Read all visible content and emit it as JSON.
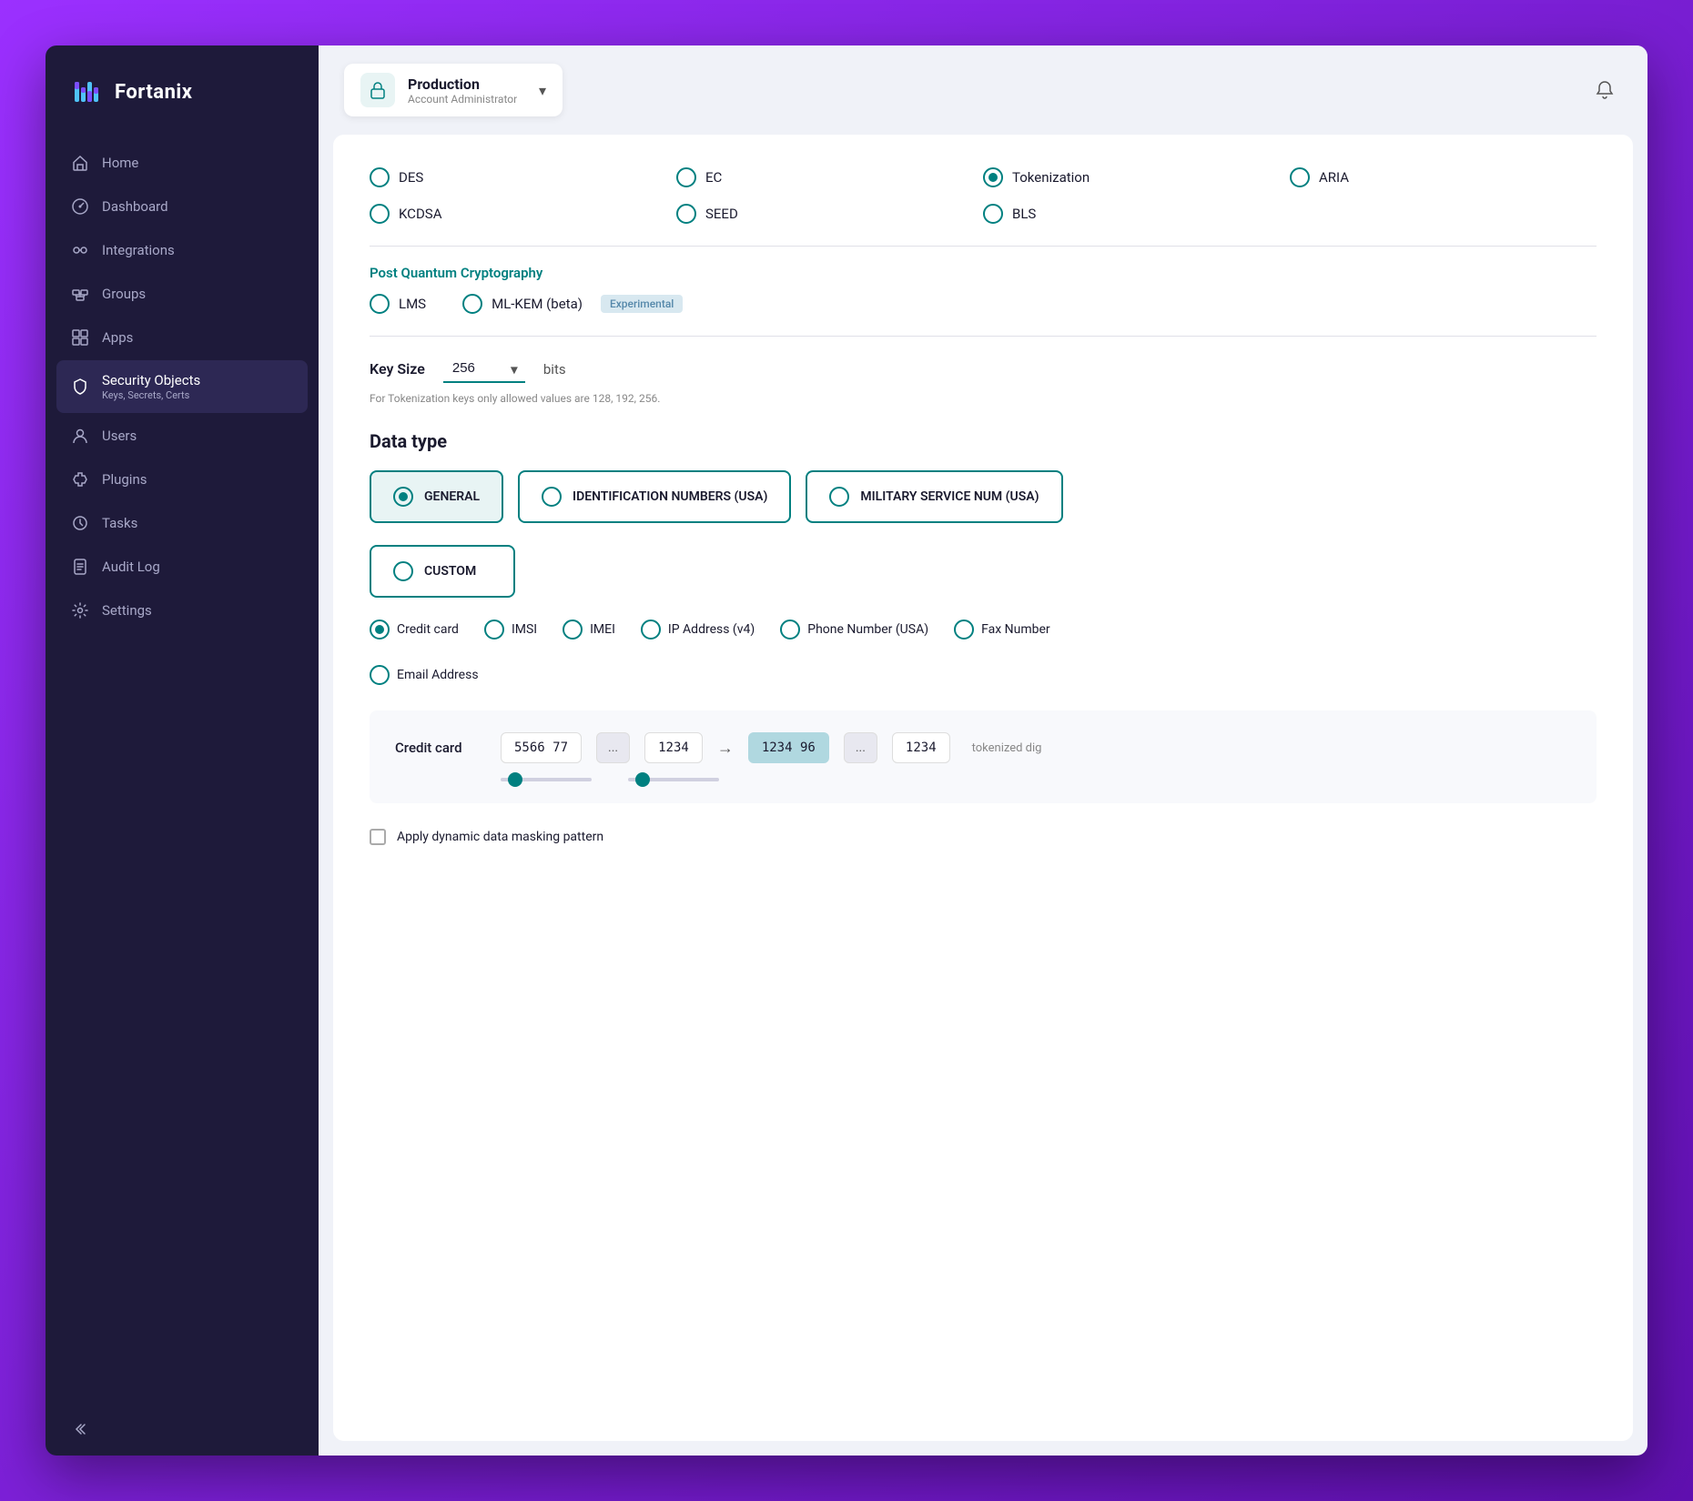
{
  "app": {
    "name": "Fortanix"
  },
  "account": {
    "name": "Production",
    "role": "Account Administrator",
    "icon": "🔒"
  },
  "sidebar": {
    "items": [
      {
        "id": "home",
        "label": "Home",
        "icon": "home"
      },
      {
        "id": "dashboard",
        "label": "Dashboard",
        "icon": "dashboard"
      },
      {
        "id": "integrations",
        "label": "Integrations",
        "icon": "integrations"
      },
      {
        "id": "groups",
        "label": "Groups",
        "icon": "groups"
      },
      {
        "id": "apps",
        "label": "Apps",
        "icon": "apps"
      },
      {
        "id": "security-objects",
        "label": "Security Objects",
        "sublabel": "Keys, Secrets, Certs",
        "icon": "security",
        "active": true
      },
      {
        "id": "users",
        "label": "Users",
        "icon": "users"
      },
      {
        "id": "plugins",
        "label": "Plugins",
        "icon": "plugins"
      },
      {
        "id": "tasks",
        "label": "Tasks",
        "icon": "tasks"
      },
      {
        "id": "audit-log",
        "label": "Audit Log",
        "icon": "audit"
      },
      {
        "id": "settings",
        "label": "Settings",
        "icon": "settings"
      }
    ],
    "collapse_label": ""
  },
  "algorithms": {
    "row1": [
      {
        "id": "des",
        "label": "DES",
        "selected": false
      },
      {
        "id": "ec",
        "label": "EC",
        "selected": false
      },
      {
        "id": "tokenization",
        "label": "Tokenization",
        "selected": true
      },
      {
        "id": "aria",
        "label": "ARIA",
        "selected": false
      }
    ],
    "row2": [
      {
        "id": "kcdsa",
        "label": "KCDSA",
        "selected": false
      },
      {
        "id": "seed",
        "label": "SEED",
        "selected": false
      },
      {
        "id": "bls",
        "label": "BLS",
        "selected": false
      }
    ]
  },
  "pqc": {
    "title": "Post Quantum Cryptography",
    "options": [
      {
        "id": "lms",
        "label": "LMS",
        "selected": false
      },
      {
        "id": "ml-kem",
        "label": "ML-KEM (beta)",
        "selected": false,
        "badge": "Experimental"
      }
    ]
  },
  "key_size": {
    "label": "Key Size",
    "value": "256",
    "options": [
      "128",
      "192",
      "256"
    ],
    "unit": "bits",
    "hint": "For Tokenization keys only allowed values are 128, 192, 256."
  },
  "data_type": {
    "section_title": "Data type",
    "options": [
      {
        "id": "general",
        "label": "GENERAL",
        "selected": true
      },
      {
        "id": "identification-numbers",
        "label": "IDENTIFICATION NUMBERS (USA)",
        "selected": false,
        "wide": true
      },
      {
        "id": "military-service",
        "label": "MILITARY SERVICE NUM (USA)",
        "selected": false,
        "wide": true
      }
    ],
    "custom": {
      "id": "custom",
      "label": "CUSTOM",
      "selected": false
    }
  },
  "token_options": [
    {
      "id": "credit-card",
      "label": "Credit card",
      "selected": true
    },
    {
      "id": "imsi",
      "label": "IMSI",
      "selected": false
    },
    {
      "id": "imei",
      "label": "IMEI",
      "selected": false
    },
    {
      "id": "ip-address",
      "label": "IP Address (v4)",
      "selected": false
    },
    {
      "id": "phone-number",
      "label": "Phone Number (USA)",
      "selected": false
    },
    {
      "id": "fax-number",
      "label": "Fax Number",
      "selected": false
    },
    {
      "id": "email-address",
      "label": "Email Address",
      "selected": false
    }
  ],
  "credit_card_preview": {
    "label": "Credit card",
    "original": {
      "group1": "5566 77",
      "ellipsis": "...",
      "group2": "1234"
    },
    "tokenized": {
      "group1": "1234 96",
      "ellipsis": "...",
      "group2": "1234"
    },
    "suffix": "tokenized dig"
  },
  "masking": {
    "label": "Apply dynamic data masking pattern",
    "checked": false
  },
  "colors": {
    "teal": "#008080",
    "sidebar_bg": "#1e1a3a",
    "sidebar_active": "#2d2854"
  }
}
